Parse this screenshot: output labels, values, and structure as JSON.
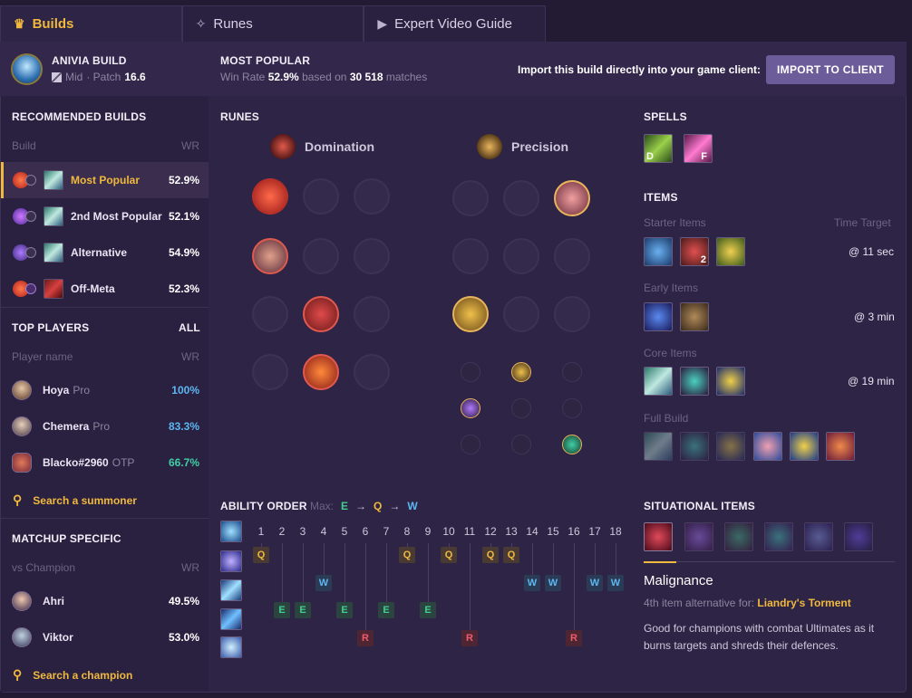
{
  "tabs": [
    {
      "label": "Builds",
      "icon": "builds-icon"
    },
    {
      "label": "Runes",
      "icon": "runes-icon"
    },
    {
      "label": "Expert Video Guide",
      "icon": "video-icon"
    }
  ],
  "header": {
    "build_title": "ANIVIA BUILD",
    "role": "Mid",
    "patch_prefix": "· Patch",
    "patch": "16.6",
    "most_popular": "MOST POPULAR",
    "win_rate_label": "Win Rate",
    "win_rate": "52.9%",
    "based_on": "based on",
    "matches": "30 518",
    "matches_label": "matches",
    "import_text": "Import this build directly into your game client:",
    "import_button": "IMPORT TO CLIENT"
  },
  "sidebar": {
    "recommended_title": "RECOMMENDED BUILDS",
    "build_col": "Build",
    "wr_col": "WR",
    "builds": [
      {
        "name": "Most Popular",
        "wr": "52.9%"
      },
      {
        "name": "2nd Most Popular",
        "wr": "52.1%"
      },
      {
        "name": "Alternative",
        "wr": "54.9%"
      },
      {
        "name": "Off-Meta",
        "wr": "52.3%"
      }
    ],
    "top_players_title": "TOP PLAYERS",
    "all_label": "ALL",
    "player_col": "Player name",
    "players": [
      {
        "name": "Hoya",
        "tag": "Pro",
        "wr": "100%",
        "color": "#5cb7f0"
      },
      {
        "name": "Chemera",
        "tag": "Pro",
        "wr": "83.3%",
        "color": "#5cb7f0"
      },
      {
        "name": "Blacko#2960",
        "tag": "OTP",
        "wr": "66.7%",
        "color": "#3fcfa6"
      }
    ],
    "search_summoner": "Search a summoner",
    "matchup_title": "MATCHUP SPECIFIC",
    "vs_col": "vs Champion",
    "matchups": [
      {
        "name": "Ahri",
        "wr": "49.5%"
      },
      {
        "name": "Viktor",
        "wr": "53.0%"
      }
    ],
    "search_champion": "Search a champion"
  },
  "runes": {
    "title": "RUNES",
    "primary": "Domination",
    "secondary": "Precision"
  },
  "spells": {
    "title": "SPELLS",
    "keys": [
      "D",
      "F"
    ]
  },
  "items": {
    "title": "ITEMS",
    "starter": "Starter Items",
    "time_target": "Time Target",
    "starter_time": "@ 11 sec",
    "potion_count": "2",
    "early": "Early Items",
    "early_time": "@ 3 min",
    "core": "Core Items",
    "core_time": "@ 19 min",
    "full": "Full Build"
  },
  "ability": {
    "title": "ABILITY ORDER",
    "max_label": "Max:",
    "max_order": [
      "E",
      "Q",
      "W"
    ],
    "levels": [
      "1",
      "2",
      "3",
      "4",
      "5",
      "6",
      "7",
      "8",
      "9",
      "10",
      "11",
      "12",
      "13",
      "14",
      "15",
      "16",
      "17",
      "18"
    ],
    "sequence": [
      "Q",
      "E",
      "E",
      "W",
      "E",
      "R",
      "E",
      "Q",
      "E",
      "Q",
      "R",
      "Q",
      "Q",
      "W",
      "W",
      "R",
      "W",
      "W"
    ]
  },
  "situational": {
    "title": "SITUATIONAL ITEMS",
    "item_name": "Malignance",
    "alt_prefix": "4th item alternative for:",
    "alt_item": "Liandry's Torment",
    "description": "Good for champions with combat Ultimates as it burns targets and shreds their defences."
  },
  "colors": {
    "accent": "#f0b93d",
    "button": "#6c5d9a",
    "q": "#f0b93d",
    "w": "#5cb7f0",
    "e": "#3fcf8e",
    "r": "#ef5b6b"
  }
}
